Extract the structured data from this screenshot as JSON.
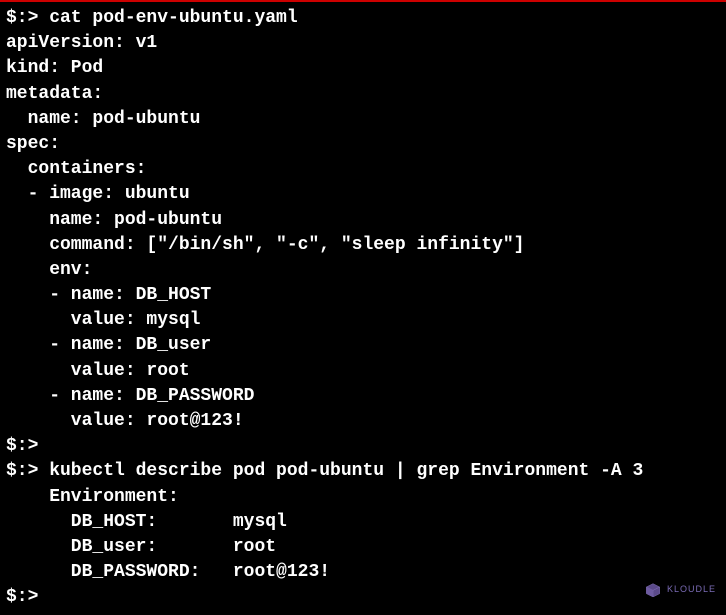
{
  "terminal": {
    "lines": [
      "$:> cat pod-env-ubuntu.yaml",
      "apiVersion: v1",
      "kind: Pod",
      "metadata:",
      "  name: pod-ubuntu",
      "spec:",
      "  containers:",
      "  - image: ubuntu",
      "    name: pod-ubuntu",
      "    command: [\"/bin/sh\", \"-c\", \"sleep infinity\"]",
      "    env:",
      "    - name: DB_HOST",
      "      value: mysql",
      "    - name: DB_user",
      "      value: root",
      "    - name: DB_PASSWORD",
      "      value: root@123!",
      "$:>",
      "$:> kubectl describe pod pod-ubuntu | grep Environment -A 3",
      "    Environment:",
      "      DB_HOST:       mysql",
      "      DB_user:       root",
      "      DB_PASSWORD:   root@123!",
      "$:>"
    ]
  },
  "watermark": {
    "text": "KLOUDLE"
  }
}
